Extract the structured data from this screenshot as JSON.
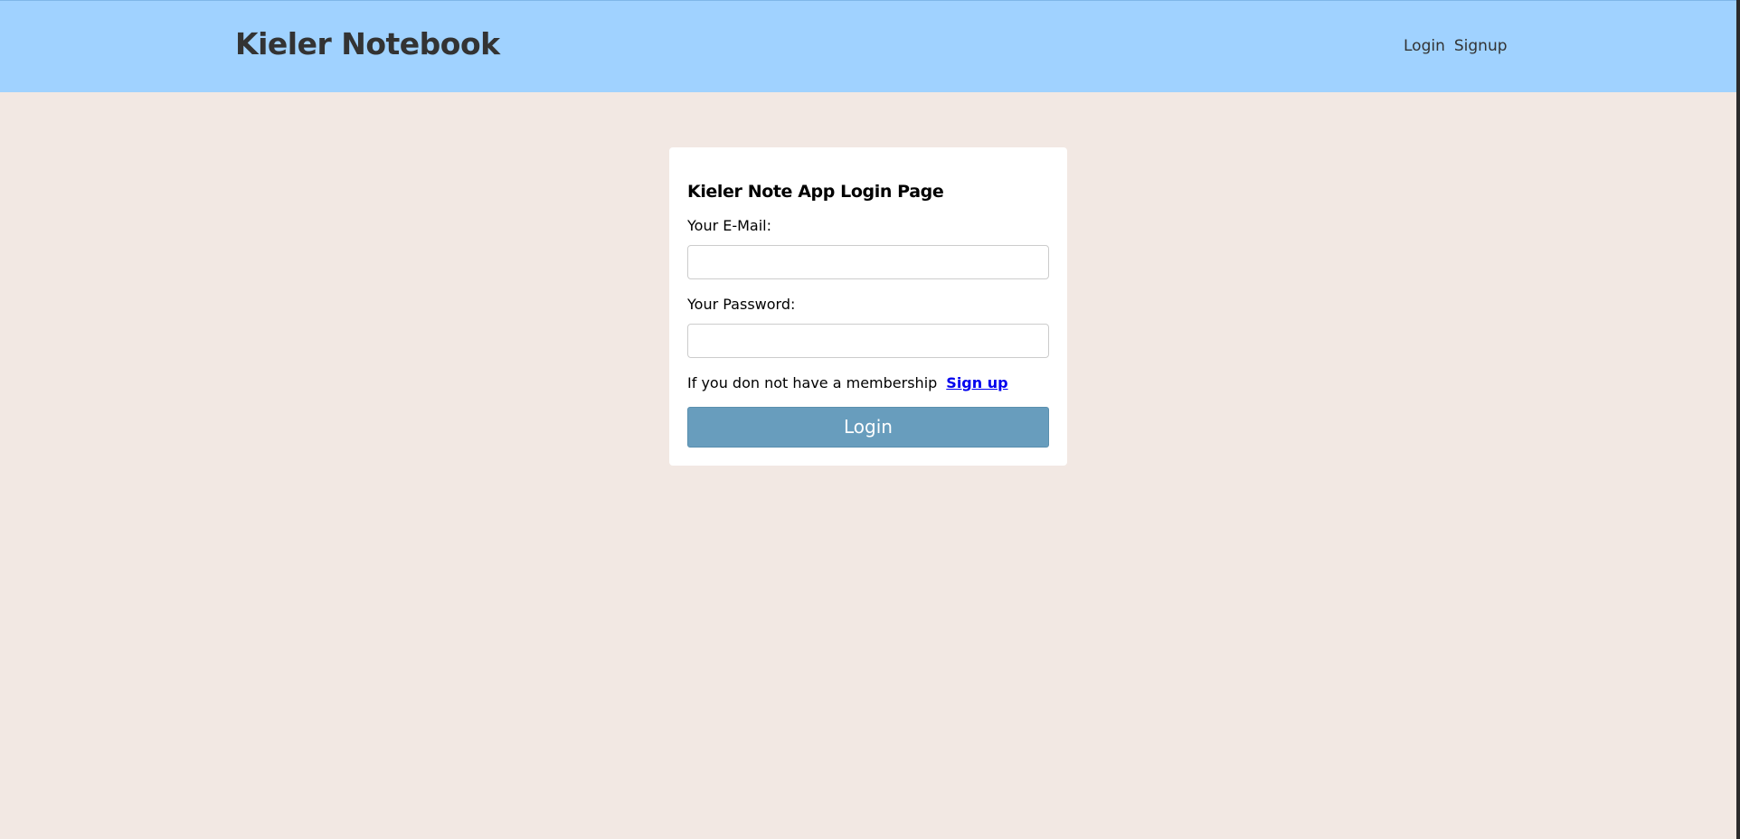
{
  "header": {
    "brand": "Kieler Notebook",
    "nav": [
      {
        "label": "Login"
      },
      {
        "label": "Signup"
      }
    ]
  },
  "login_card": {
    "title": "Kieler Note App Login Page",
    "email": {
      "label": "Your E-Mail:",
      "value": "",
      "placeholder": ""
    },
    "password": {
      "label": "Your Password:",
      "value": "",
      "placeholder": ""
    },
    "membership_text": "If you don not have a membership",
    "signup_link": "Sign up",
    "login_button": "Login"
  },
  "colors": {
    "header_bg": "#a0d2ff",
    "page_bg": "#f2e8e3",
    "button_bg": "#689dbd",
    "link": "#0000ee"
  }
}
